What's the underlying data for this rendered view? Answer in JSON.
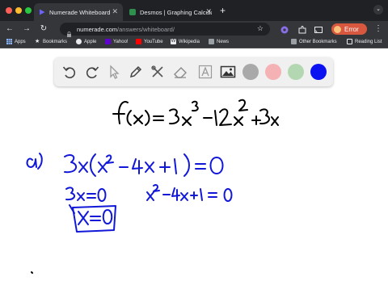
{
  "tabs": [
    {
      "label": "Numerade Whiteboard",
      "active": true,
      "favicon": "numerade-play-icon"
    },
    {
      "label": "Desmos | Graphing Calculat",
      "active": false,
      "favicon": "desmos-icon"
    }
  ],
  "address": {
    "host": "numerade.com",
    "path": "/answers/whiteboard/"
  },
  "profile": {
    "label": "Error"
  },
  "bookmarks": [
    {
      "label": "Apps",
      "icon": "apps-grid-icon"
    },
    {
      "label": "Bookmarks",
      "icon": "star-icon"
    },
    {
      "label": "Apple",
      "icon": "apple-icon"
    },
    {
      "label": "Yahoo!",
      "icon": "yahoo-icon"
    },
    {
      "label": "YouTube",
      "icon": "youtube-icon"
    },
    {
      "label": "Wikipedia",
      "icon": "wikipedia-icon"
    },
    {
      "label": "News",
      "icon": "news-icon"
    }
  ],
  "bookmarks_right": [
    {
      "label": "Other Bookmarks",
      "icon": "folder-icon"
    },
    {
      "label": "Reading List",
      "icon": "reading-list-icon"
    }
  ],
  "whiteboard": {
    "tools": [
      "undo-icon",
      "redo-icon",
      "pointer-icon",
      "pencil-icon",
      "tools-icon",
      "eraser-icon",
      "text-icon",
      "image-icon"
    ],
    "colors": [
      {
        "name": "gray",
        "hex": "#a9a9a9"
      },
      {
        "name": "pink",
        "hex": "#f4b2b4"
      },
      {
        "name": "green",
        "hex": "#b3d8b1"
      },
      {
        "name": "blue",
        "hex": "#0a12f2",
        "selected": true
      }
    ],
    "ink_colors": {
      "black": "#000000",
      "blue": "#1218d8"
    }
  }
}
